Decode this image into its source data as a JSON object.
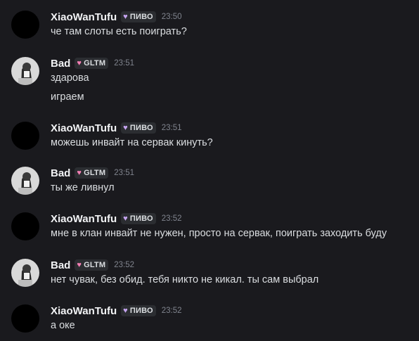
{
  "messages": [
    {
      "user": "XiaoWanTufu",
      "tag": "ПИВО",
      "tag_color": "#c6a4f0",
      "time": "23:50",
      "avatar": "black",
      "lines": [
        "че там слоты есть поиграть?"
      ]
    },
    {
      "user": "Bad",
      "tag": "GLTM",
      "tag_color": "#f47fb4",
      "time": "23:51",
      "avatar": "photo",
      "lines": [
        "здарова",
        "играем"
      ]
    },
    {
      "user": "XiaoWanTufu",
      "tag": "ПИВО",
      "tag_color": "#c6a4f0",
      "time": "23:51",
      "avatar": "black",
      "lines": [
        "можешь инвайт на сервак кинуть?"
      ]
    },
    {
      "user": "Bad",
      "tag": "GLTM",
      "tag_color": "#f47fb4",
      "time": "23:51",
      "avatar": "photo",
      "lines": [
        "ты же ливнул"
      ]
    },
    {
      "user": "XiaoWanTufu",
      "tag": "ПИВО",
      "tag_color": "#c6a4f0",
      "time": "23:52",
      "avatar": "black",
      "lines": [
        "мне в клан инвайт не нужен, просто на сервак, поиграть заходить буду"
      ]
    },
    {
      "user": "Bad",
      "tag": "GLTM",
      "tag_color": "#f47fb4",
      "time": "23:52",
      "avatar": "photo",
      "lines": [
        "нет чувак, без обид. тебя никто не кикал. ты сам выбрал"
      ]
    },
    {
      "user": "XiaoWanTufu",
      "tag": "ПИВО",
      "tag_color": "#c6a4f0",
      "time": "23:52",
      "avatar": "black",
      "lines": [
        "а оке"
      ]
    }
  ]
}
